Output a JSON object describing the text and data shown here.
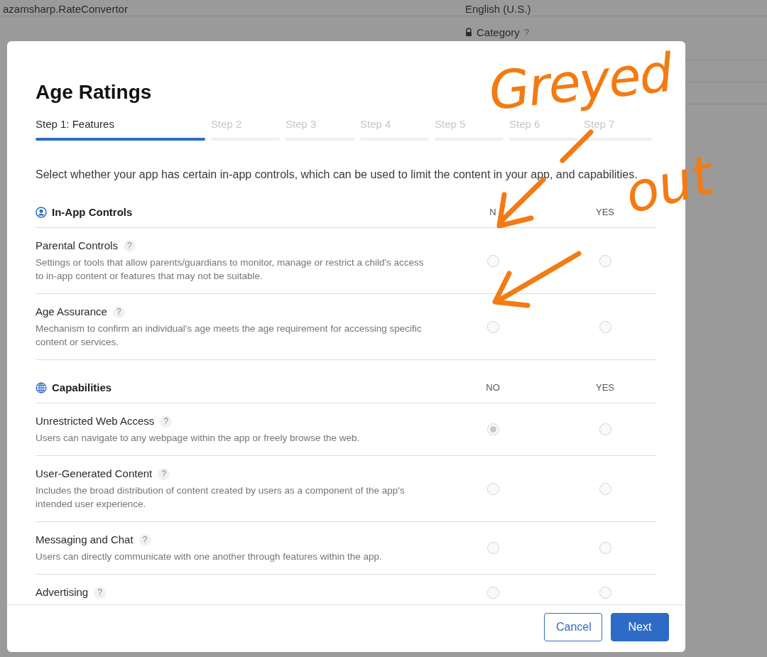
{
  "background": {
    "bundle_id": "azamsharp.RateConvertor",
    "language": "English (U.S.)",
    "category_label": "Category",
    "category_help": "?"
  },
  "dialog": {
    "title": "Age Ratings",
    "steps": [
      {
        "label": "Step 1: Features",
        "selected": true
      },
      {
        "label": "Step 2",
        "selected": false
      },
      {
        "label": "Step 3",
        "selected": false
      },
      {
        "label": "Step 4",
        "selected": false
      },
      {
        "label": "Step 5",
        "selected": false
      },
      {
        "label": "Step 6",
        "selected": false
      },
      {
        "label": "Step 7",
        "selected": false
      }
    ],
    "intro": "Select whether your app has certain in-app controls, which can be used to limit the content in your app, and capabilities.",
    "sections": [
      {
        "kind": "controls",
        "title": "In-App Controls",
        "no_label": "N",
        "yes_label": "YES",
        "items": [
          {
            "title": "Parental Controls",
            "help": "?",
            "description": "Settings or tools that allow parents/guardians to monitor, manage or restrict a child's access to in-app content or features that may not be suitable.",
            "disabled": true,
            "no": {
              "selected": false
            },
            "yes": {
              "selected": false
            }
          },
          {
            "title": "Age Assurance",
            "help": "?",
            "description": "Mechanism to confirm an individual's age meets the age requirement for accessing specific content or services.",
            "disabled": true,
            "no": {
              "selected": false
            },
            "yes": {
              "selected": false
            }
          }
        ]
      },
      {
        "kind": "capabilities",
        "title": "Capabilities",
        "no_label": "NO",
        "yes_label": "YES",
        "items": [
          {
            "title": "Unrestricted Web Access",
            "help": "?",
            "description": "Users can navigate to any webpage within the app or freely browse the web.",
            "disabled": true,
            "no": {
              "selected": true
            },
            "yes": {
              "selected": false
            }
          },
          {
            "title": "User-Generated Content",
            "help": "?",
            "description": "Includes the broad distribution of content created by users as a component of the app's intended user experience.",
            "disabled": true,
            "no": {
              "selected": false
            },
            "yes": {
              "selected": false
            }
          },
          {
            "title": "Messaging and Chat",
            "help": "?",
            "description": "Users can directly communicate with one another through features within the app.",
            "disabled": true,
            "no": {
              "selected": false
            },
            "yes": {
              "selected": false
            }
          },
          {
            "title": "Advertising",
            "help": "?",
            "disabled": true,
            "no": {
              "selected": false
            },
            "yes": {
              "selected": false
            }
          }
        ]
      }
    ],
    "buttons": [
      {
        "kind": "secondary",
        "label": "Cancel"
      },
      {
        "kind": "primary",
        "label": "Next"
      }
    ]
  },
  "annotation": {
    "lines": [
      "Greyed",
      "out"
    ]
  }
}
